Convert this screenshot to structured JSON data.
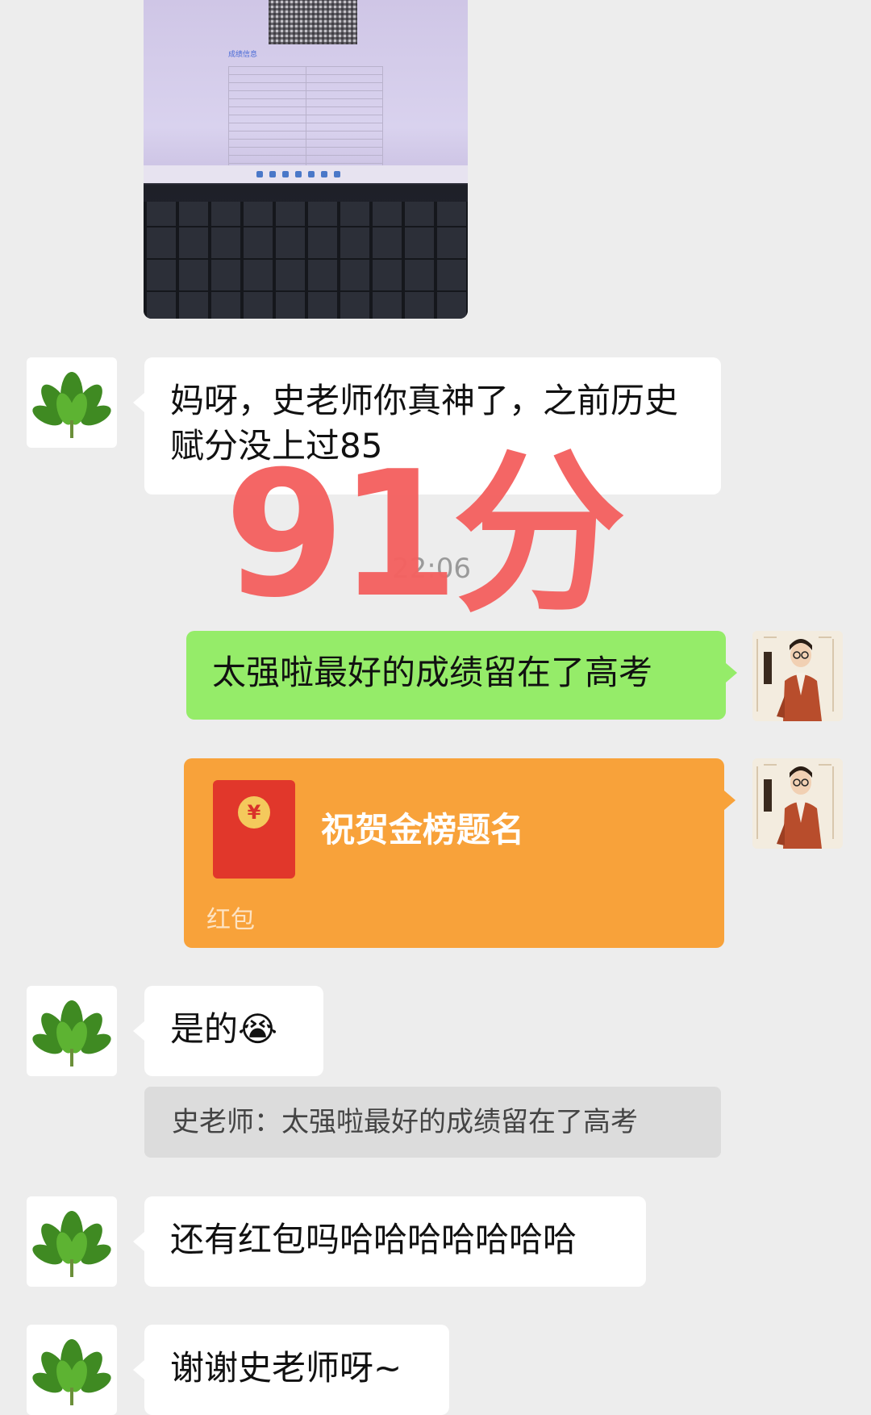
{
  "colors": {
    "background": "#ededed",
    "incoming_bubble": "#ffffff",
    "outgoing_bubble": "#95ec69",
    "red_packet": "#f8a23a",
    "stamp": "#f46261"
  },
  "messages": {
    "m1": "妈呀，史老师你真神了，之前历史赋分没上过85",
    "timestamp": "22:06",
    "m2": "太强啦最好的成绩留在了高考",
    "red_packet": {
      "greeting": "祝贺金榜题名",
      "label": "红包",
      "coin": "¥"
    },
    "m3_text": "是的",
    "m3_emoji": "😭",
    "m3_quote": "史老师：太强啦最好的成绩留在了高考",
    "m4": "还有红包吗哈哈哈哈哈哈哈",
    "m5": "谢谢史老师呀~"
  },
  "overlay": {
    "stamp_text": "91分"
  },
  "photo": {
    "doc_title": "成绩信息"
  },
  "icons": {
    "student_avatar": "leaf-avatar-icon",
    "teacher_avatar": "teacher-portrait-icon"
  }
}
